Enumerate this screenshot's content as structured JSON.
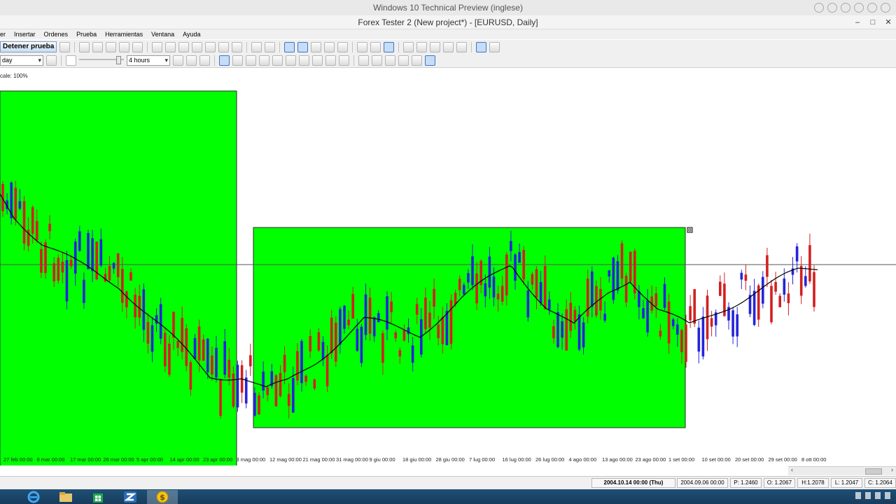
{
  "window": {
    "os_title": "Windows 10 Technical Preview (inglese)",
    "app_title": "Forex Tester 2  (New project*) - [EURUSD, Daily]",
    "controls": [
      "–",
      "□",
      "✕"
    ]
  },
  "menu": [
    "er",
    "Insertar",
    "Ordenes",
    "Prueba",
    "Herramientas",
    "Ventana",
    "Ayuda"
  ],
  "toolbar": {
    "stop_label": "Detener prueba",
    "timeframe_value": "day",
    "speed_value": "4 hours"
  },
  "chart": {
    "scale_label": "cale: 100%",
    "colors": {
      "bull": "#2424d8",
      "bear": "#d22020",
      "ma": "#000000",
      "highlight": "#00ff00",
      "crosshair": "#555555"
    },
    "date_labels": [
      "27 feb 00:00",
      "8 mar 00:00",
      "17 mar 00:00",
      "26 mar 00:00",
      "5 apr 00:00",
      "14 apr 00:00",
      "23 apr 00:00",
      "3 mag 00:00",
      "12 mag 00:00",
      "21 mag 00:00",
      "31 mag 00:00",
      "9 giu 00:00",
      "18 giu 00:00",
      "28 giu 00:00",
      "7 lug 00:00",
      "16 lug 00:00",
      "26 lug 00:00",
      "4 ago 00:00",
      "13 ago 00:00",
      "23 ago 00:00",
      "1 set 00:00",
      "10 set 00:00",
      "20 set 00:00",
      "29 set 00:00",
      "8 ott 00:00"
    ]
  },
  "status": {
    "current_time": "2004.10.14 00:00 (Thu)",
    "cursor_time": "2004.09.06 00:00",
    "price": "P: 1.2460",
    "open": "O: 1.2067",
    "high": "H:1.2078",
    "low": "L: 1.2047",
    "close": "C: 1.2064"
  },
  "taskbar": {
    "apps": [
      "ie-icon",
      "file-explorer-icon",
      "store-icon",
      "forex-tester-icon",
      "dollar-icon"
    ]
  }
}
